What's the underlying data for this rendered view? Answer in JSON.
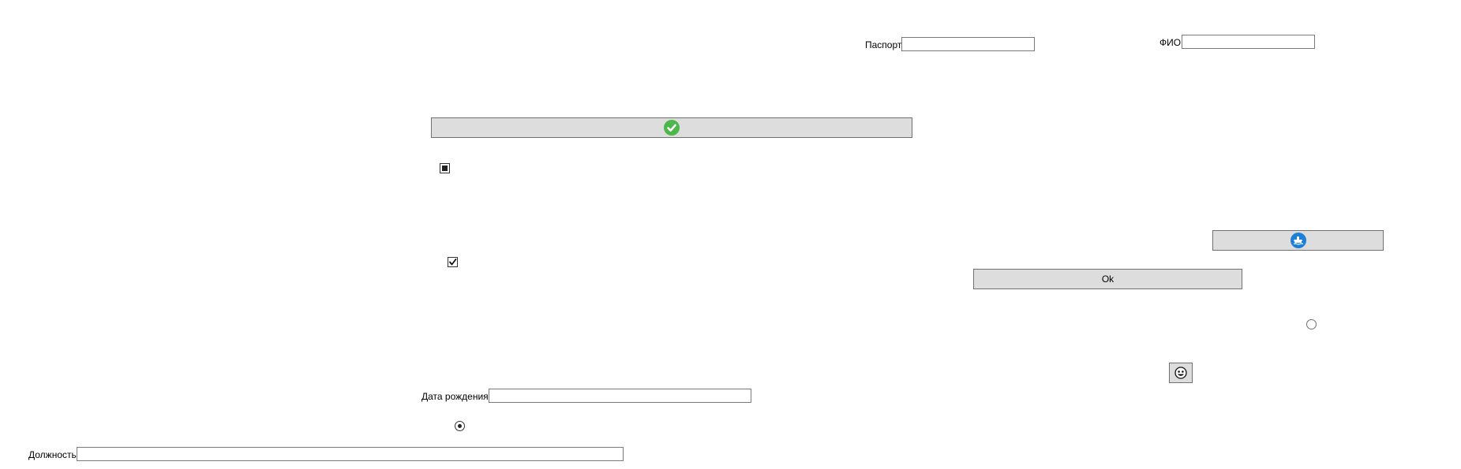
{
  "fields": {
    "passport": {
      "label": "Паспорт",
      "value": ""
    },
    "fio": {
      "label": "ФИО",
      "value": ""
    },
    "birth_date": {
      "label": "Дата рождения",
      "value": ""
    },
    "position": {
      "label": "Должность",
      "value": ""
    }
  },
  "buttons": {
    "confirm": {
      "icon": "check-circle-icon",
      "color": "#4cb74a"
    },
    "ok": {
      "label": "Ok"
    },
    "ship": {
      "icon": "ship-icon",
      "color": "#1e7fd6"
    },
    "smiley": {
      "icon": "smiley-icon"
    }
  },
  "checkboxes": {
    "indeterminate": {
      "state": "indeterminate"
    },
    "checked": {
      "state": "checked"
    }
  },
  "radios": {
    "selected": {
      "checked": true
    },
    "unselected": {
      "checked": false
    }
  }
}
